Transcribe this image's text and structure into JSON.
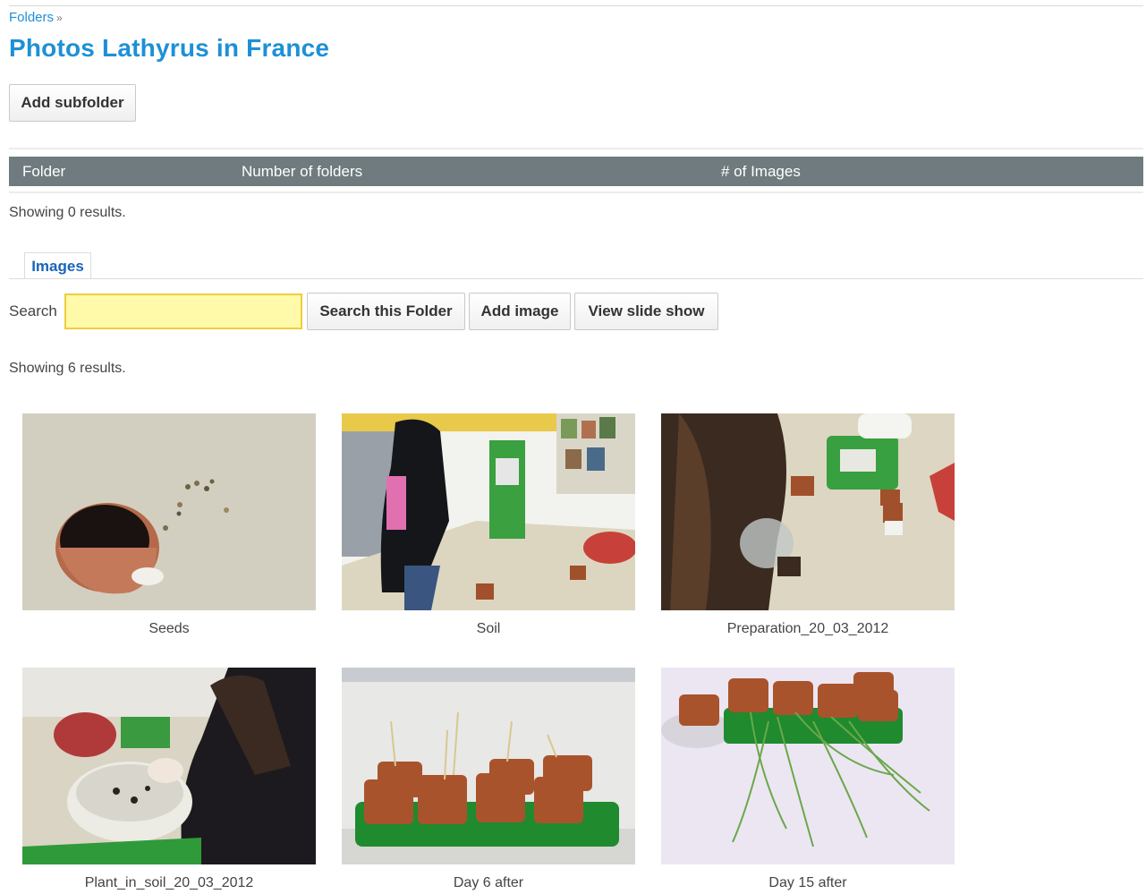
{
  "breadcrumb": {
    "folders_label": "Folders",
    "separator": "»"
  },
  "page_title": "Photos Lathyrus in France",
  "buttons": {
    "add_subfolder": "Add subfolder",
    "search_folder": "Search this Folder",
    "add_image": "Add image",
    "view_slide_show": "View slide show"
  },
  "folder_table": {
    "columns": [
      "Folder",
      "Number of folders",
      "# of Images"
    ],
    "showing": "Showing 0 results."
  },
  "tabs": {
    "images": "Images"
  },
  "search": {
    "label": "Search",
    "value": ""
  },
  "images_showing": "Showing 6 results.",
  "images": [
    {
      "caption": "Seeds"
    },
    {
      "caption": "Soil"
    },
    {
      "caption": "Preparation_20_03_2012"
    },
    {
      "caption": "Plant_in_soil_20_03_2012"
    },
    {
      "caption": "Day 6 after"
    },
    {
      "caption": "Day 15 after"
    }
  ],
  "colors": {
    "link": "#1e90d6",
    "header_bar": "#6f7b7e",
    "search_bg": "#fffaaa"
  }
}
